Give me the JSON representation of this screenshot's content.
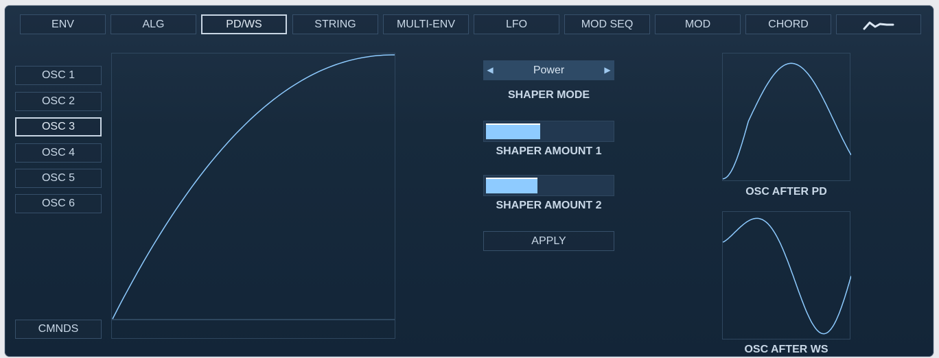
{
  "tabs": [
    {
      "label": "ENV",
      "active": false
    },
    {
      "label": "ALG",
      "active": false
    },
    {
      "label": "PD/WS",
      "active": true
    },
    {
      "label": "STRING",
      "active": false
    },
    {
      "label": "MULTI-ENV",
      "active": false
    },
    {
      "label": "LFO",
      "active": false
    },
    {
      "label": "MOD SEQ",
      "active": false
    },
    {
      "label": "MOD",
      "active": false
    },
    {
      "label": "CHORD",
      "active": false
    },
    {
      "label": "",
      "icon": "waveform-icon",
      "active": false
    }
  ],
  "oscillators": [
    {
      "label": "OSC 1",
      "active": false
    },
    {
      "label": "OSC 2",
      "active": false
    },
    {
      "label": "OSC 3",
      "active": true
    },
    {
      "label": "OSC 4",
      "active": false
    },
    {
      "label": "OSC 5",
      "active": false
    },
    {
      "label": "OSC 6",
      "active": false
    }
  ],
  "cmnds_label": "CMNDS",
  "shaper": {
    "mode_value": "Power",
    "mode_label": "SHAPER MODE",
    "prev_icon": "left-arrow-icon",
    "next_icon": "right-arrow-icon",
    "amount1_label": "SHAPER AMOUNT 1",
    "amount1_value": 0.43,
    "amount2_label": "SHAPER AMOUNT 2",
    "amount2_value": 0.41,
    "apply_label": "APPLY"
  },
  "previews": {
    "after_pd_label": "OSC AFTER PD",
    "after_ws_label": "OSC AFTER WS"
  },
  "colors": {
    "panel_bg": "#172a3c",
    "curve": "#8ecbff",
    "slider_fill": "#8ecbff",
    "text": "#c9d8e7"
  }
}
